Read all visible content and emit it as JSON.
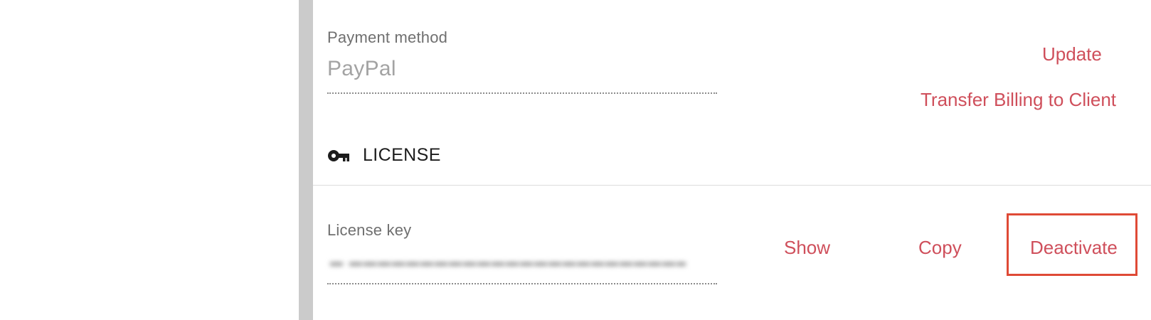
{
  "billing": {
    "payment_method_label": "Payment method",
    "payment_method_value": "PayPal",
    "update_label": "Update",
    "transfer_label": "Transfer Billing to Client"
  },
  "license": {
    "section_title": "LICENSE",
    "section_icon": "key-icon",
    "license_key_label": "License key",
    "show_label": "Show",
    "copy_label": "Copy",
    "deactivate_label": "Deactivate"
  },
  "colors": {
    "accent_link": "#cf4f5b",
    "highlight_box": "#df4a36",
    "gutter_bar": "#cbcbcb"
  }
}
